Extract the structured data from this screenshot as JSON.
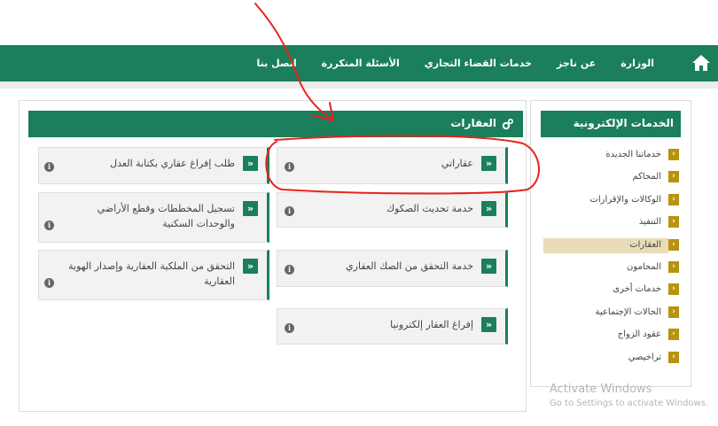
{
  "nav": {
    "items": [
      "الوزارة",
      "عن ناجز",
      "خدمات القضاء التجاري",
      "الأسئلة المتكررة",
      "اتصل بنا"
    ]
  },
  "main": {
    "title": "العقارات",
    "cards": [
      {
        "label": "عقاراتي",
        "highlighted": true
      },
      {
        "label": "خدمة تحديث الصكوك"
      },
      {
        "label": "خدمة التحقق من الصك العقاري"
      },
      {
        "label": "إفراغ العقار إلكترونيا"
      },
      {
        "label": "طلب إفراغ عقاري بكتابة العدل"
      },
      {
        "label": "تسجيل المخططات وقطع الأراضي والوحدات السكنية"
      },
      {
        "label": "التحقق من الملكية العقارية وإصدار الهوية العقارية"
      }
    ]
  },
  "sidebar": {
    "title": "الخدمات الإلكترونية",
    "items": [
      {
        "label": "خدماتنا الجديدة"
      },
      {
        "label": "المحاكم"
      },
      {
        "label": "الوكالات والإقرارات"
      },
      {
        "label": "التنفيذ"
      },
      {
        "label": "العقارات",
        "active": true
      },
      {
        "label": "المحامون"
      },
      {
        "label": "خدمات أخرى"
      },
      {
        "label": "الحالات الإجتماعية"
      },
      {
        "label": "عقود الزواج"
      },
      {
        "label": "تراخيصي"
      }
    ]
  },
  "watermark": {
    "line1": "Activate Windows",
    "line2": "Go to Settings to activate Windows."
  },
  "colors": {
    "primary": "#1a7f5a",
    "sidebar_chevron": "#b8930e",
    "active_highlight": "#e8dcb8",
    "annotation": "#e8231c"
  },
  "icons": {
    "home": "home-icon",
    "gear": "gear-icon",
    "chevron": "double-chevron-left-icon",
    "info": "info-icon"
  }
}
